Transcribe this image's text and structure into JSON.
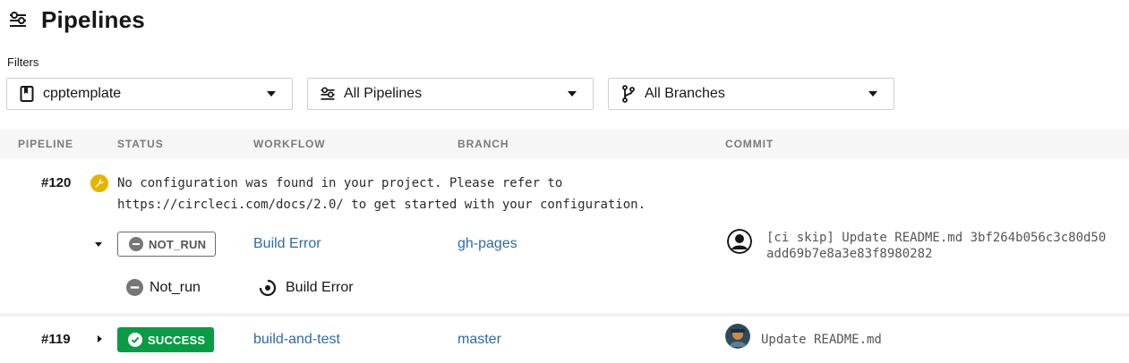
{
  "header": {
    "title": "Pipelines",
    "icon": "pipelines-icon"
  },
  "filters": {
    "label": "Filters",
    "project": {
      "value": "cpptemplate",
      "icon": "repo-icon"
    },
    "pipelines": {
      "value": "All Pipelines",
      "icon": "pipelines-icon"
    },
    "branches": {
      "value": "All Branches",
      "icon": "branch-icon"
    }
  },
  "table": {
    "columns": [
      "PIPELINE",
      "STATUS",
      "WORKFLOW",
      "BRANCH",
      "COMMIT"
    ]
  },
  "pipelines": [
    {
      "number": "#120",
      "message_line1": "No configuration was found in your project. Please refer to",
      "message_line2": "https://circleci.com/docs/2.0/ to get started with your configuration.",
      "status": "NOT_RUN",
      "workflow": "Build Error",
      "branch": "gh-pages",
      "commit_line1": "[ci skip] Update README.md 3bf264b056c3c80d50",
      "commit_line2": "add69b7e8a3e83f8980282",
      "job": {
        "status": "Not_run",
        "name": "Build Error"
      }
    },
    {
      "number": "#119",
      "status": "SUCCESS",
      "workflow": "build-and-test",
      "branch": "master",
      "commit_line1": "Update README.md"
    }
  ],
  "colors": {
    "success": "#0a9b46",
    "warning": "#e6b400",
    "link": "#2f6aa7",
    "header_bg": "#f6f6f6"
  }
}
